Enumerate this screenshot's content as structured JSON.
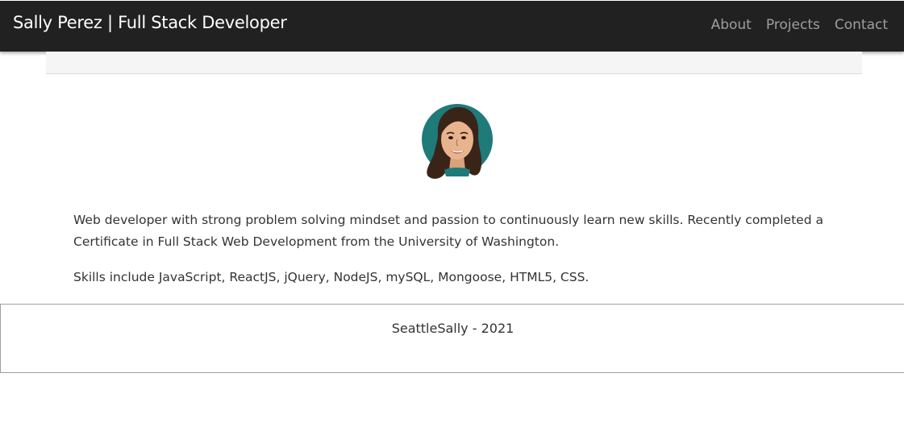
{
  "navbar": {
    "brand": "Sally Perez | Full Stack Developer",
    "links": [
      "About",
      "Projects",
      "Contact"
    ]
  },
  "profile": {
    "avatar_icon": "cartoon-portrait-avatar",
    "bio": "Web developer with strong problem solving mindset and passion to continuously learn new skills. Recently completed a Certificate in Full Stack Web Development from the University of Washington.",
    "skills": "Skills include JavaScript, ReactJS, jQuery, NodeJS, mySQL, Mongoose, HTML5, CSS."
  },
  "footer": {
    "text": "SeattleSally - 2021"
  },
  "colors": {
    "navbar_bg": "#212121",
    "nav_link": "#9e9e9e",
    "avatar_bg": "#1f7a7a"
  }
}
